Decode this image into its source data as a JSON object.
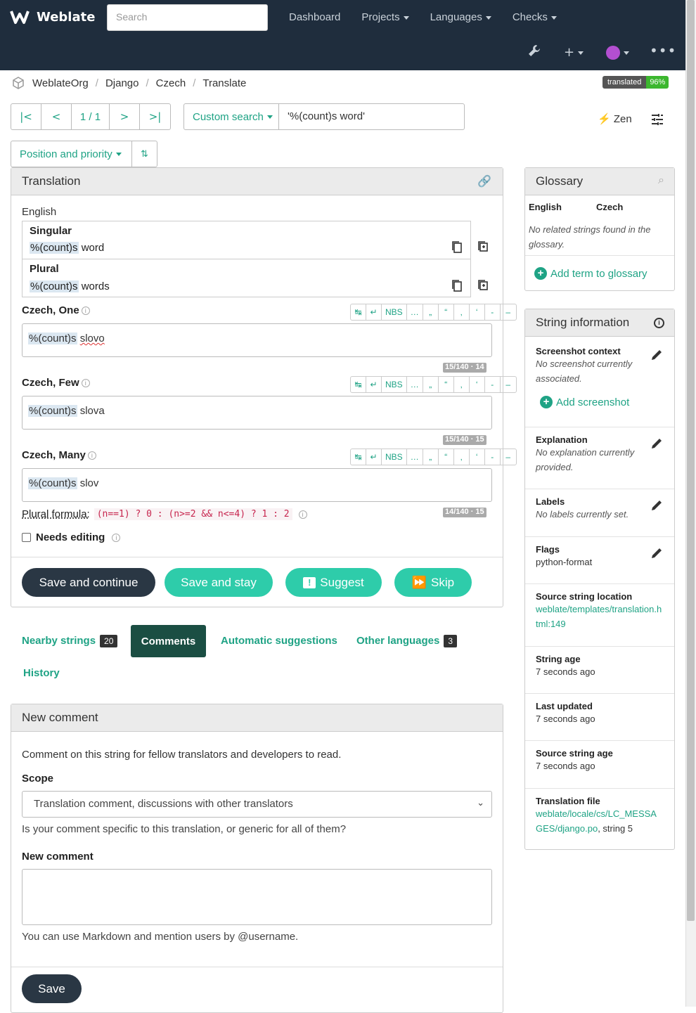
{
  "nav": {
    "brand": "Weblate",
    "search_placeholder": "Search",
    "links": [
      "Dashboard",
      "Projects",
      "Languages",
      "Checks"
    ]
  },
  "breadcrumb": [
    "WeblateOrg",
    "Django",
    "Czech",
    "Translate"
  ],
  "translated_badge": {
    "label": "translated",
    "value": "96%"
  },
  "pager": {
    "count": "1 / 1"
  },
  "custom_search": {
    "label": "Custom search",
    "value": "'%(count)s word'"
  },
  "zen": "Zen",
  "sort": {
    "label": "Position and priority"
  },
  "translation": {
    "title": "Translation",
    "source_lang": "English",
    "singular_label": "Singular",
    "singular_ph": "%(count)s",
    "singular_rest": " word",
    "plural_label": "Plural",
    "plural_ph": "%(count)s",
    "plural_rest": " words",
    "forms": [
      {
        "label": "Czech, One",
        "ph": "%(count)s",
        "rest": "slovo",
        "counter": "15/140 · 14"
      },
      {
        "label": "Czech, Few",
        "ph": "%(count)s",
        "rest": " slova",
        "counter": "15/140 · 15"
      },
      {
        "label": "Czech, Many",
        "ph": "%(count)s",
        "rest": " slov",
        "counter": "14/140 · 15"
      }
    ],
    "toolbar": [
      "↹",
      "↵",
      "NBS",
      "…",
      "„",
      "“",
      "‚",
      "‘",
      "-",
      "–"
    ],
    "plural_formula_label": "Plural formula:",
    "plural_formula": "(n==1) ? 0 : (n>=2 && n<=4) ? 1 : 2",
    "needs_editing": "Needs editing",
    "buttons": {
      "save_continue": "Save and continue",
      "save_stay": "Save and stay",
      "suggest": "Suggest",
      "skip": "Skip"
    }
  },
  "tabs": {
    "nearby": "Nearby strings",
    "nearby_count": "20",
    "comments": "Comments",
    "automatic": "Automatic suggestions",
    "other": "Other languages",
    "other_count": "3",
    "history": "History"
  },
  "comment": {
    "title": "New comment",
    "intro": "Comment on this string for fellow translators and developers to read.",
    "scope_label": "Scope",
    "scope_value": "Translation comment, discussions with other translators",
    "scope_help": "Is your comment specific to this translation, or generic for all of them?",
    "new_label": "New comment",
    "markdown_help": "You can use Markdown and mention users by @username.",
    "save": "Save"
  },
  "glossary": {
    "title": "Glossary",
    "col_en": "English",
    "col_cs": "Czech",
    "empty": "No related strings found in the glossary.",
    "add": "Add term to glossary"
  },
  "info": {
    "title": "String information",
    "screenshot_label": "Screenshot context",
    "screenshot_value": "No screenshot currently associated.",
    "add_screenshot": "Add screenshot",
    "explanation_label": "Explanation",
    "explanation_value": "No explanation currently provided.",
    "labels_label": "Labels",
    "labels_value": "No labels currently set.",
    "flags_label": "Flags",
    "flags_value": "python-format",
    "location_label": "Source string location",
    "location_value": "weblate/templates/translation.html:149",
    "age_label": "String age",
    "age_value": "7 seconds ago",
    "updated_label": "Last updated",
    "updated_value": "7 seconds ago",
    "src_age_label": "Source string age",
    "src_age_value": "7 seconds ago",
    "file_label": "Translation file",
    "file_value": "weblate/locale/cs/LC_MESSAGES/django.po",
    "file_suffix": ", string 5"
  }
}
